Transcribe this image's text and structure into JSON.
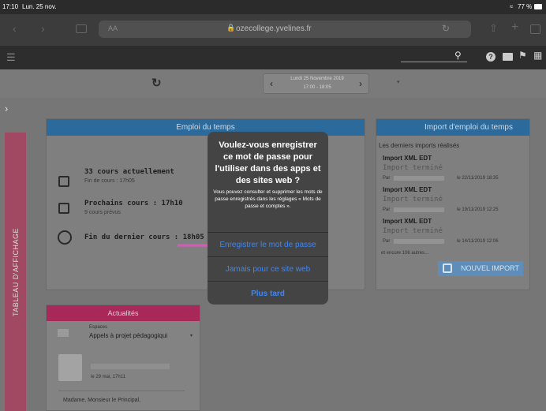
{
  "status_bar": {
    "time": "17:10",
    "date": "Lun. 25 nov.",
    "battery": "77 %"
  },
  "browser": {
    "text_size_label": "AA",
    "url": "ozecollege.yvelines.fr"
  },
  "date_nav": {
    "date_line": "Lundi 25 Novembre 2019",
    "time_line": "17:00 - 18:05"
  },
  "side_tab": {
    "label": "TABLEAU D'AFFICHAGE"
  },
  "emploi_du_temps": {
    "title": "Emploi du temps",
    "items": [
      {
        "main": "33 cours actuellement",
        "sub": "Fin de cours : 17h05"
      },
      {
        "main": "Prochains cours : 17h10",
        "sub": "9 cours prévus"
      },
      {
        "main": "Fin du dernier cours : 18h05",
        "sub": ""
      }
    ]
  },
  "import_panel": {
    "title": "Import d'emploi du temps",
    "subtitle": "Les derniers imports réalisés",
    "imports": [
      {
        "title": "Import XML EDT",
        "status": "Import terminé",
        "by": "Par",
        "date": "le 22/11/2019 18:35"
      },
      {
        "title": "Import XML EDT",
        "status": "Import terminé",
        "by": "Par",
        "date": "le 19/11/2019 12:25"
      },
      {
        "title": "Import XML EDT",
        "status": "Import terminé",
        "by": "Par",
        "date": "le 14/11/2019 12:06"
      }
    ],
    "more": "et encore 106 autres...",
    "new_import": "NOUVEL IMPORT"
  },
  "actualites": {
    "title": "Actualités",
    "space_label": "Espaces",
    "topic": "Appels à projet pédagogiqui",
    "date": "le 29 mai, 17h11",
    "message": "Madame, Monsieur le Principal,"
  },
  "dialog": {
    "title": "Voulez-vous enregistrer ce mot de passe pour l'utiliser dans des apps et des sites web ?",
    "message": "Vous pouvez consulter et supprimer les mots de passe enregistrés dans les réglages « Mots de passe et comptes ».",
    "save_button": "Enregistrer le mot de passe",
    "never_button": "Jamais pour ce site web",
    "later_button": "Plus tard"
  },
  "colors": {
    "accent": "#3f86f2",
    "arrow": "#d65bb8",
    "header_blue": "#2d6a9c",
    "actualites_red": "#a8285a"
  }
}
